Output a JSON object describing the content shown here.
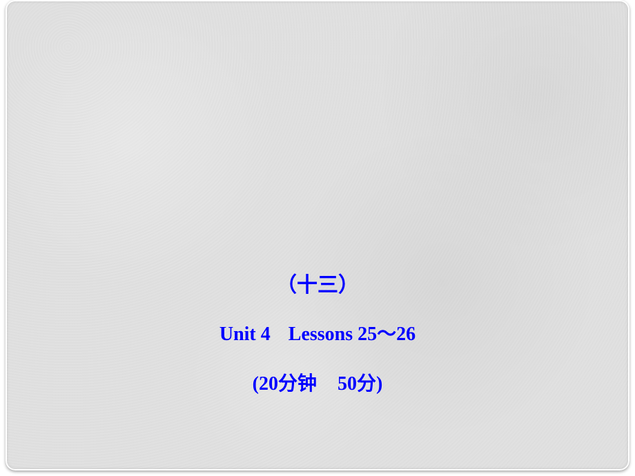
{
  "slide": {
    "line1": "（十三）",
    "line2_left": "Unit 4",
    "line2_right": "Lessons 25～26",
    "line3_left": "(20分钟",
    "line3_right": "50分)"
  }
}
